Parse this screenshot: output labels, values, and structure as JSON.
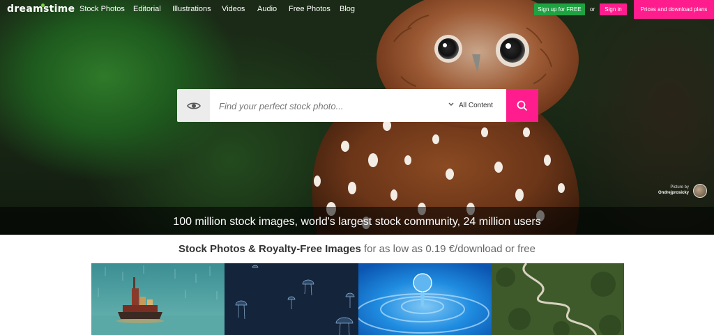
{
  "logo": {
    "text": "dreamstime"
  },
  "nav": {
    "links": [
      "Stock Photos",
      "Editorial",
      "Illustrations",
      "Videos",
      "Audio",
      "Free Photos",
      "Blog"
    ],
    "signup_label": "Sign up for FREE",
    "or_label": "or",
    "signin_label": "Sign in",
    "prices_label": "Prices and download plans"
  },
  "search": {
    "placeholder": "Find your perfect stock photo...",
    "value": "",
    "filter_label": "All Content",
    "icons": {
      "left": "eye-icon",
      "filter": "chevron-down-icon",
      "submit": "search-icon"
    }
  },
  "hero": {
    "credit_label": "Picture by",
    "credit_name": "Ondrejprosicky",
    "tagline": "100 million stock images, world's largest stock community, 24 million users"
  },
  "subhead": {
    "bold": "Stock Photos & Royalty-Free Images",
    "rest": " for as low as 0.19 €/download or free"
  },
  "gallery": {
    "tiles": [
      "cargo-ship",
      "jellyfish",
      "water-drop",
      "winding-road"
    ]
  },
  "colors": {
    "signup": "#1fa342",
    "accent": "#ff1d8e",
    "logo_dot": "#7cd142"
  }
}
